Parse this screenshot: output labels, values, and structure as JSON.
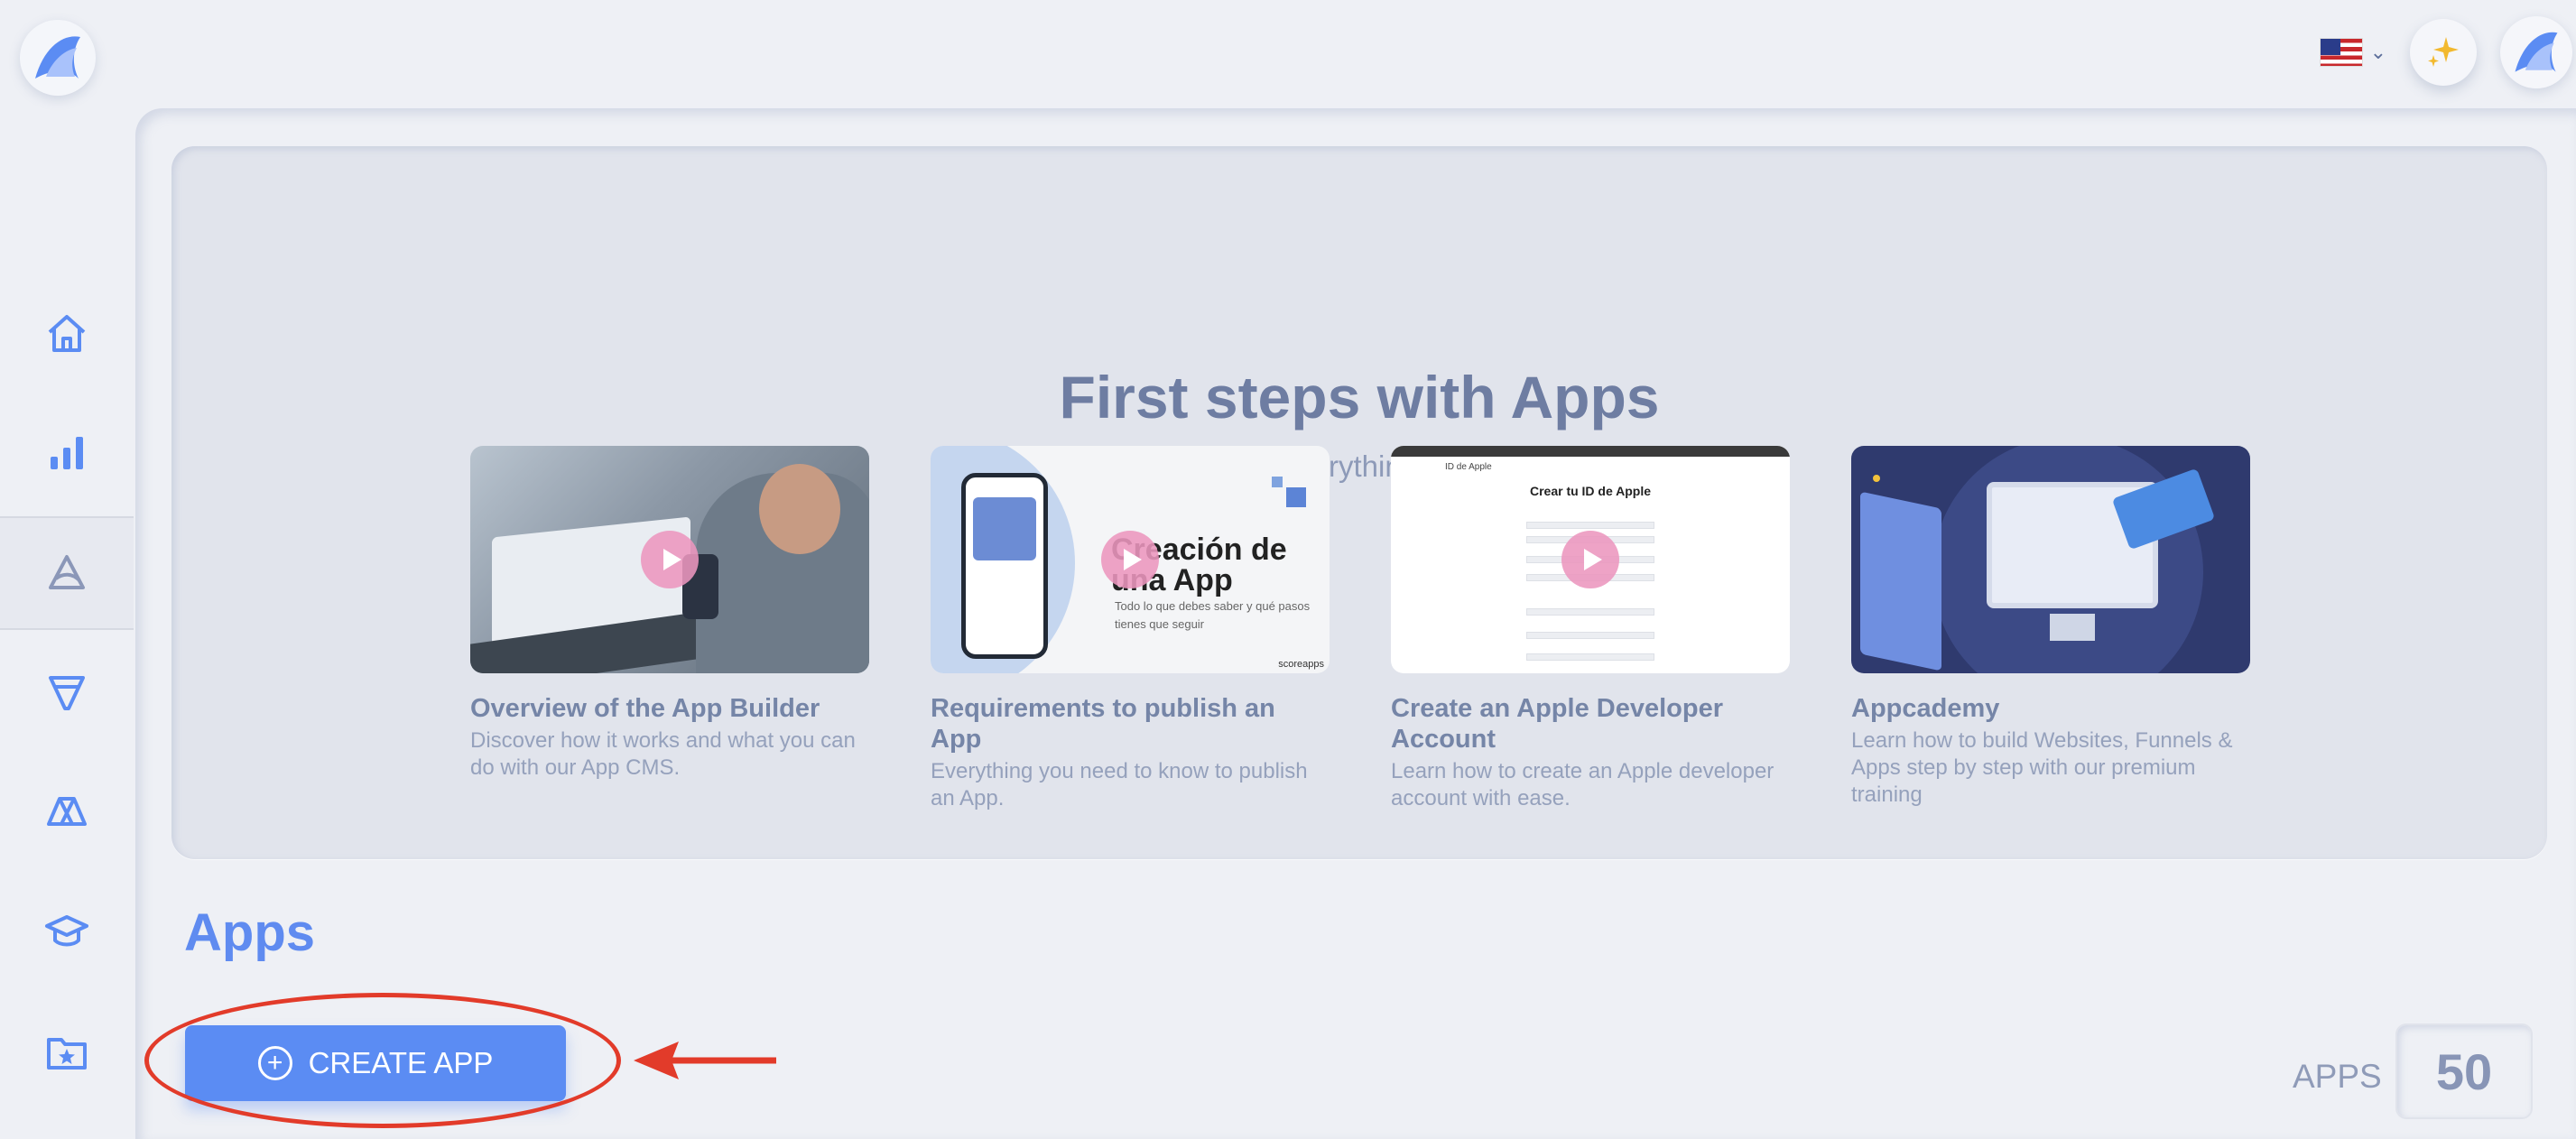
{
  "topbar": {
    "logo_icon": "app-logo-icon",
    "language_flag": "us-flag-icon",
    "sparkle_icon": "sparkle-icon",
    "avatar_icon": "app-logo-avatar-icon"
  },
  "sidebar": {
    "items": [
      {
        "name": "home",
        "icon": "home-icon"
      },
      {
        "name": "analytics",
        "icon": "bar-chart-icon"
      },
      {
        "name": "apps",
        "icon": "app-triangle-icon",
        "active": true
      },
      {
        "name": "funnels",
        "icon": "funnel-icon"
      },
      {
        "name": "websites",
        "icon": "triangle-shapes-icon"
      },
      {
        "name": "academy",
        "icon": "graduation-cap-icon"
      },
      {
        "name": "favorites",
        "icon": "folder-star-icon"
      }
    ]
  },
  "hero": {
    "title": "First steps with Apps",
    "subtitle": "A series of videos to learn everything you need to build your App.",
    "cards": [
      {
        "title": "Overview of the App Builder",
        "description": "Discover how it works and what you can do with our App CMS."
      },
      {
        "title": "Requirements to publish an App",
        "description": "Everything you need to know to publish an App.",
        "thumb_heading": "Creación de una App",
        "thumb_text": "Todo lo que debes saber y qué pasos tienes que seguir",
        "thumb_brand": "scoreapps"
      },
      {
        "title": "Create an Apple Developer Account",
        "description": "Learn how to create an Apple developer account with ease.",
        "thumb_label": "ID de Apple",
        "thumb_heading": "Crear tu ID de Apple"
      },
      {
        "title": "Appcademy",
        "description": "Learn how to build Websites, Funnels & Apps step by step with our premium training"
      }
    ]
  },
  "apps": {
    "title": "Apps",
    "create_label": "CREATE APP",
    "count_label": "APPS",
    "count_value": "50"
  },
  "colors": {
    "accent": "#5b8cf3",
    "highlight": "#e23b2a",
    "background": "#eef0f5"
  }
}
